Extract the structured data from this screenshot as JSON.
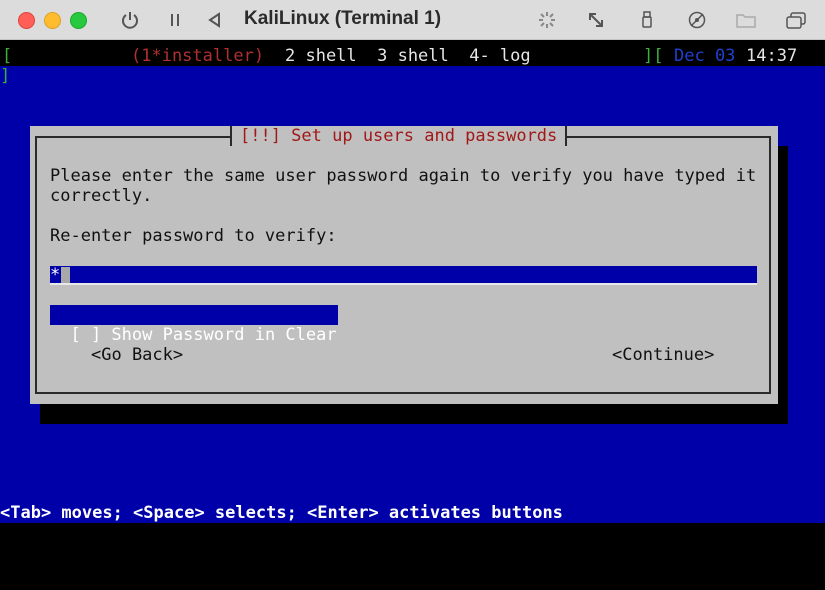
{
  "window": {
    "title": "KaliLinux (Terminal 1)",
    "icons": [
      "power-icon",
      "pause-icon",
      "back-icon",
      "brightness-icon",
      "resize-icon",
      "usb-icon",
      "disc-icon",
      "folder-icon",
      "window-icon"
    ]
  },
  "statusbar": {
    "open_bracket": "[",
    "active_window": "(1*installer)",
    "windows": "2 shell  3 shell  4- log",
    "right_bracket": "][",
    "date": "Dec 03",
    "time": "14:37",
    "line2_bracket": "]"
  },
  "dialog": {
    "title": "[!!] Set up users and passwords",
    "message_line1": "Please enter the same user password again to verify you have typed it",
    "message_line2": "correctly.",
    "prompt": "Re-enter password to verify:",
    "password_mask": "*",
    "show_password_label": "[ ] Show Password in Clear",
    "go_back_label": "<Go Back>",
    "continue_label": "<Continue>"
  },
  "help_line": "<Tab> moves; <Space> selects; <Enter> activates buttons",
  "colors": {
    "console_blue": "#0000a8",
    "dialog_gray": "#c0c0c0",
    "title_red": "#a01818"
  }
}
